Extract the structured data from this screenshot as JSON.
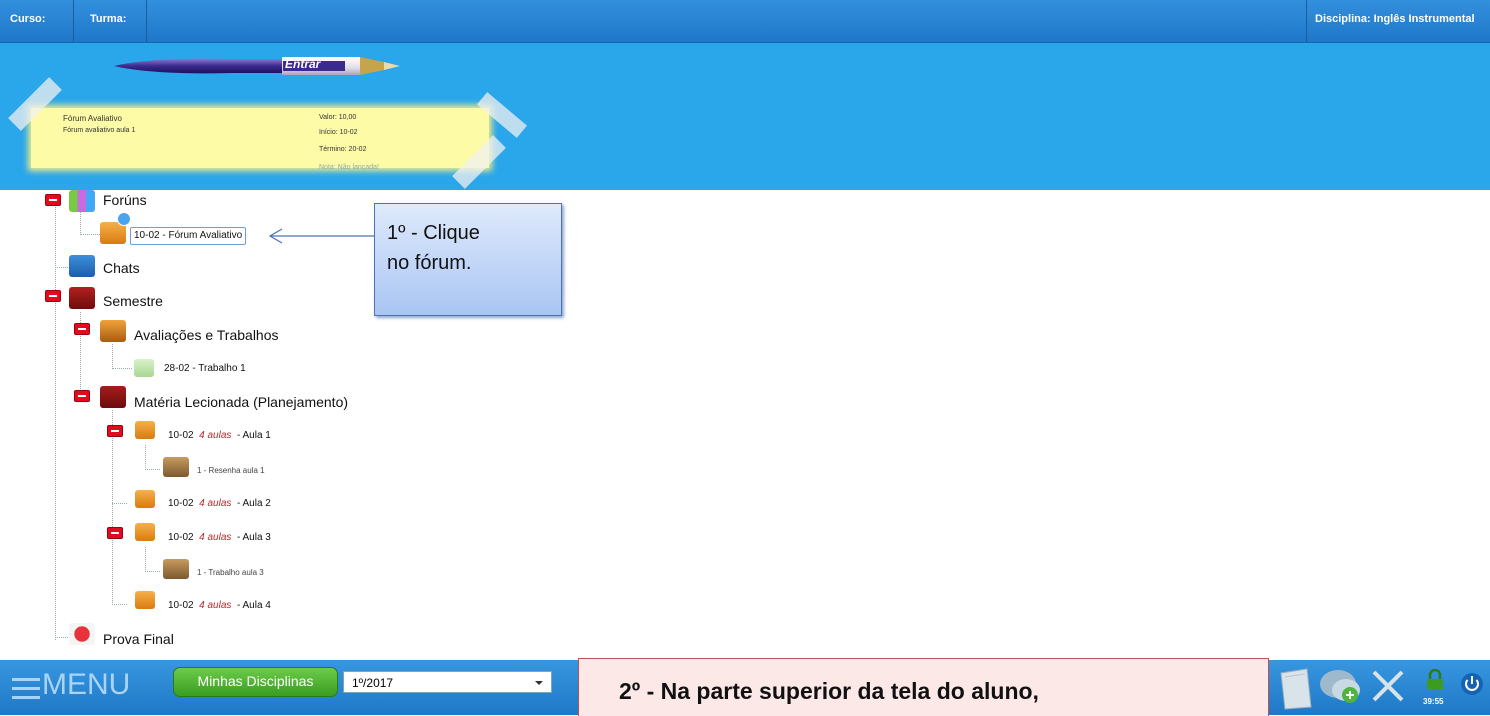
{
  "header": {
    "curso_label": "Curso:",
    "turma_label": "Turma:",
    "disciplina_label": "Disciplina: Inglês Instrumental"
  },
  "pen_button": {
    "label": "Entrar"
  },
  "note": {
    "title": "Fórum Avaliativo",
    "subtitle": "Fórum avaliativo aula 1",
    "valor": "Valor: 10,00",
    "inicio": "Início: 10-02",
    "termino": "Término: 20-02",
    "nota": "Nota: Não lançada!"
  },
  "tree": {
    "foruns": "Forúns",
    "forum_item": "10-02 - Fórum Avaliativo",
    "chats": "Chats",
    "semestre": "Semestre",
    "avaliacoes": "Avaliações e Trabalhos",
    "trabalho1": "28-02 - Trabalho 1",
    "materia": "Matéria Lecionada (Planejamento)",
    "aulas_tag": "4 aulas",
    "aula1": "10-02",
    "aula1_name": "- Aula 1",
    "resenha": "1 - Resenha aula 1",
    "aula2": "10-02",
    "aula2_name": "- Aula 2",
    "aula3": "10-02",
    "aula3_name": "- Aula 3",
    "trabalho_aula3": "1 - Trabalho aula 3",
    "aula4": "10-02",
    "aula4_name": "- Aula 4",
    "prova_final": "Prova Final"
  },
  "callout1": {
    "line1": "1º - Clique",
    "line2": "no fórum."
  },
  "bottom": {
    "menu_label": "MENU",
    "minhas_label": "Minhas Disciplinas",
    "semester_value": "1º/2017",
    "timer": "39:55"
  },
  "callout2": {
    "text": "2º - Na parte superior da tela do aluno,"
  },
  "colors": {
    "header_blue": "#2aa6ea",
    "strip_blue": "#1f77c9",
    "note_yellow": "#fdfba6",
    "minus_red": "#e30a1d",
    "green_button": "#3a9d21"
  }
}
